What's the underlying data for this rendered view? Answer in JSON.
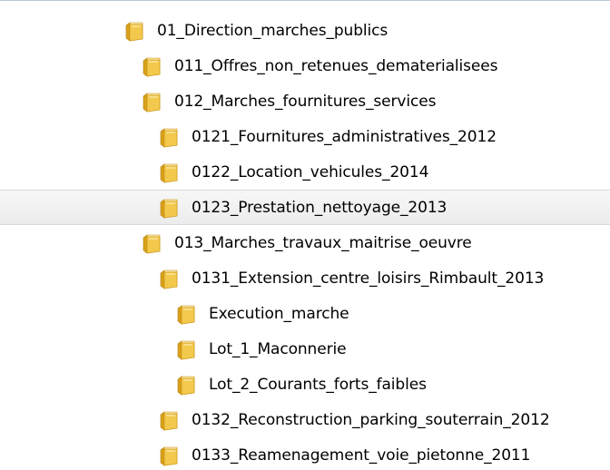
{
  "tree": {
    "items": [
      {
        "label": "01_Direction_marches_publics",
        "level": 0,
        "icon": "folder-icon"
      },
      {
        "label": "011_Offres_non_retenues_dematerialisees",
        "level": 1,
        "icon": "folder-icon"
      },
      {
        "label": "012_Marches_fournitures_services",
        "level": 1,
        "icon": "folder-icon"
      },
      {
        "label": "0121_Fournitures_administratives_2012",
        "level": 2,
        "icon": "folder-icon"
      },
      {
        "label": "0122_Location_vehicules_2014",
        "level": 2,
        "icon": "folder-icon"
      },
      {
        "label": "0123_Prestation_nettoyage_2013",
        "level": 2,
        "icon": "folder-icon",
        "hovered": true
      },
      {
        "label": "013_Marches_travaux_maitrise_oeuvre",
        "level": 1,
        "icon": "folder-icon"
      },
      {
        "label": "0131_Extension_centre_loisirs_Rimbault_2013",
        "level": 2,
        "icon": "folder-icon"
      },
      {
        "label": "Execution_marche",
        "level": 3,
        "icon": "folder-icon"
      },
      {
        "label": "Lot_1_Maconnerie",
        "level": 3,
        "icon": "folder-icon"
      },
      {
        "label": "Lot_2_Courants_forts_faibles",
        "level": 3,
        "icon": "folder-icon"
      },
      {
        "label": "0132_Reconstruction_parking_souterrain_2012",
        "level": 2,
        "icon": "folder-icon"
      },
      {
        "label": "0133_Reamenagement_voie_pietonne_2011",
        "level": 2,
        "icon": "folder-icon"
      }
    ]
  },
  "colors": {
    "hover_background": "#ececec",
    "folder_front": "#f2c94c",
    "folder_back": "#d9a21b",
    "top_border": "#b9c9da"
  }
}
